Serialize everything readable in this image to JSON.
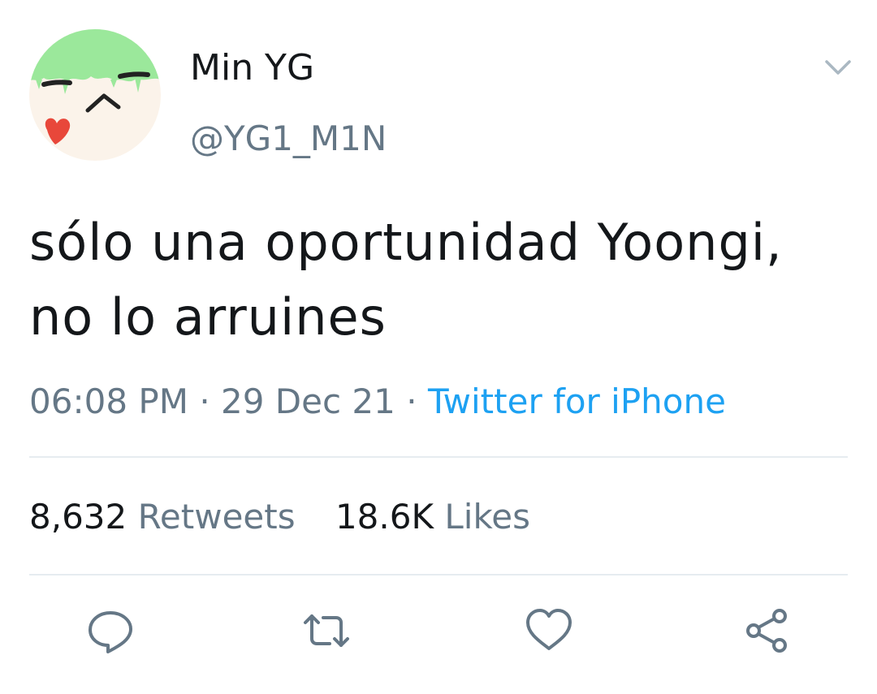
{
  "tweet": {
    "display_name": "Min YG",
    "handle": "@YG1_M1N",
    "text_line1": "sólo una oportunidad Yoongi,",
    "text_line2": "no lo arruines",
    "time": "06:08 PM",
    "date": "29 Dec 21",
    "source": "Twitter for iPhone",
    "retweets_count": "8,632",
    "retweets_label": "Retweets",
    "likes_count": "18.6K",
    "likes_label": "Likes"
  },
  "icons": {
    "caret": "chevron-down-icon",
    "reply": "reply-icon",
    "retweet": "retweet-icon",
    "like": "heart-icon",
    "share": "share-icon"
  },
  "colors": {
    "text_primary": "#14171a",
    "text_secondary": "#657786",
    "link": "#1da1f2",
    "divider": "#e6ecf0",
    "avatar_hair": "#9be89b",
    "avatar_skin": "#fbf3ea",
    "avatar_heart": "#e8473a"
  }
}
